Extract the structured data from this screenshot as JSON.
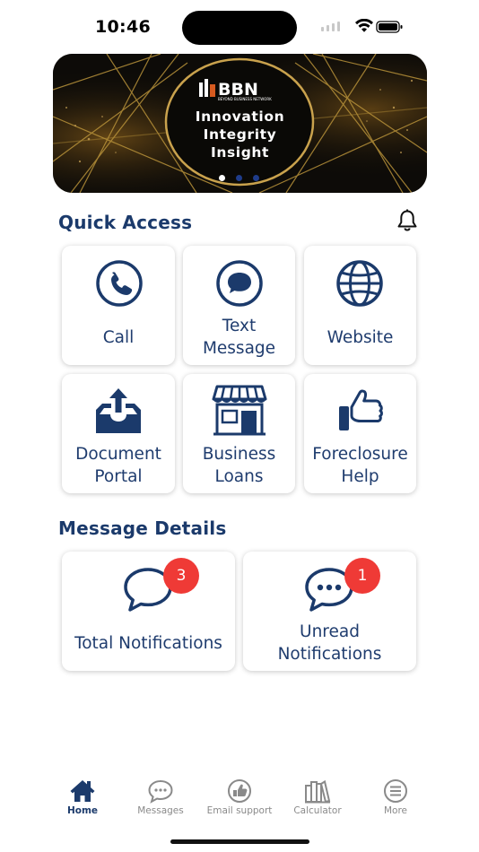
{
  "status_bar": {
    "time": "10:46"
  },
  "banner": {
    "logo_text": "BBN",
    "logo_subtitle": "BEYOND BUSINESS NETWORK",
    "line1": "Innovation",
    "line2": "Integrity",
    "line3": "Insight",
    "page_count": 3,
    "active_page": 1
  },
  "quick_access": {
    "title": "Quick Access",
    "items": [
      {
        "label": "Call",
        "icon": "phone-icon"
      },
      {
        "label": "Text Message",
        "icon": "chat-bubble-icon"
      },
      {
        "label": "Website",
        "icon": "globe-icon"
      },
      {
        "label": "Document Portal",
        "icon": "upload-tray-icon"
      },
      {
        "label": "Business Loans",
        "icon": "storefront-icon"
      },
      {
        "label": "Foreclosure Help",
        "icon": "thumbs-up-icon"
      }
    ]
  },
  "message_details": {
    "title": "Message Details",
    "total": {
      "label": "Total Notifications",
      "count": "3"
    },
    "unread": {
      "label": "Unread Notifications",
      "count": "1"
    }
  },
  "tabs": [
    {
      "label": "Home",
      "icon": "home-icon",
      "active": true
    },
    {
      "label": "Messages",
      "icon": "message-icon",
      "active": false
    },
    {
      "label": "Email support",
      "icon": "email-support-icon",
      "active": false
    },
    {
      "label": "Calculator",
      "icon": "calculator-icon",
      "active": false
    },
    {
      "label": "More",
      "icon": "menu-icon",
      "active": false
    }
  ],
  "colors": {
    "primary": "#1b3a6b",
    "badge": "#ef3a36",
    "inactive_tab": "#8a8a8a",
    "banner_gold": "#b8923a"
  }
}
